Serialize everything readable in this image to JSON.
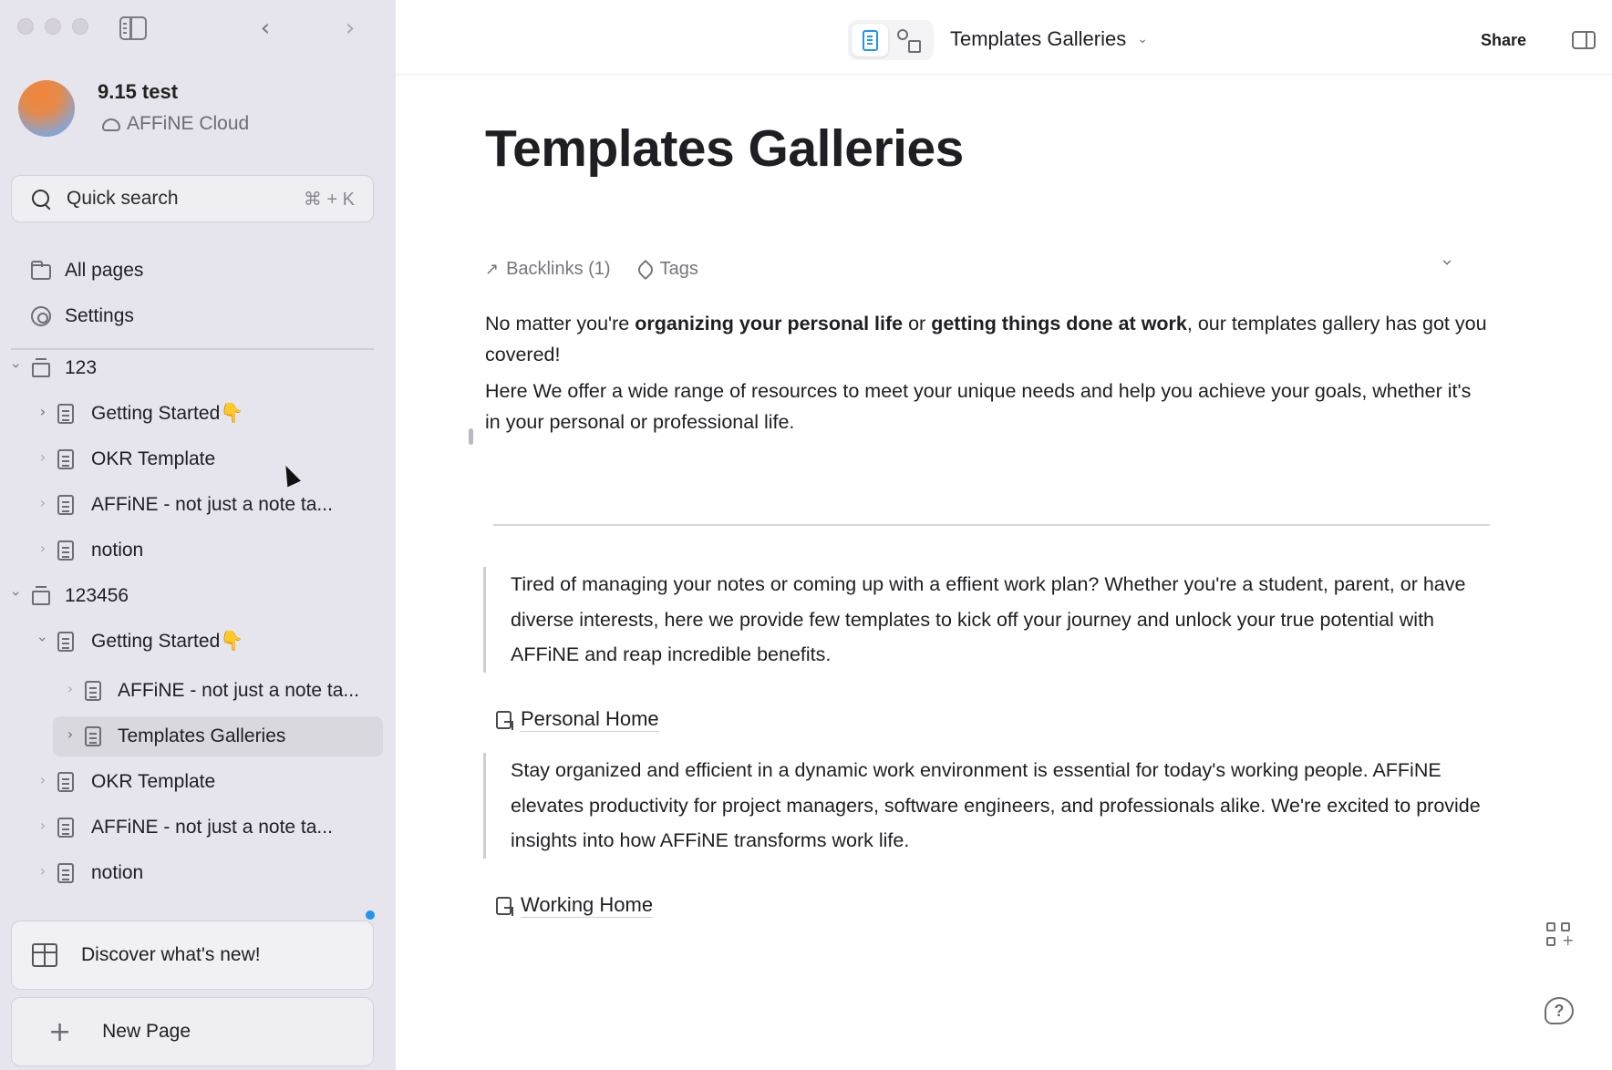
{
  "sidebar": {
    "workspace": {
      "name": "9.15 test",
      "cloud": "AFFiNE Cloud"
    },
    "search": {
      "label": "Quick search",
      "shortcut": "⌘ + K"
    },
    "nav": [
      {
        "label": "All pages",
        "icon": "folder-icon"
      },
      {
        "label": "Settings",
        "icon": "gear-icon"
      }
    ],
    "collections": [
      {
        "name": "123",
        "pages": [
          "Getting Started👇",
          "OKR Template",
          "AFFiNE - not just a note ta...",
          "notion"
        ]
      },
      {
        "name": "123456",
        "pages": [
          "Getting Started👇",
          "AFFiNE - not just a note ta...",
          "Templates Galleries",
          "OKR Template",
          "AFFiNE - not just a note ta...",
          "notion"
        ]
      }
    ],
    "discover": "Discover what's new!",
    "new_page": "New Page"
  },
  "topbar": {
    "doc_title": "Templates Galleries",
    "share": "Share"
  },
  "document": {
    "title": "Templates Galleries",
    "backlinks": "Backlinks (1)",
    "tags": "Tags",
    "intro": {
      "p1": "No matter you're ",
      "b1": "organizing your personal life",
      "p2": " or ",
      "b2": "getting things done at work",
      "p3": ", our templates gallery has got you covered!"
    },
    "para2": "Here We offer a wide range of resources to meet your unique needs and help you achieve your goals, whether it's in your personal or professional life.",
    "quote1": "Tired of managing your notes or coming up with a effient work plan? Whether you're a student, parent, or have diverse interests, here we provide  few templates to kick off your journey and unlock your true potential with AFFiNE and reap incredible benefits.",
    "link1": "Personal Home",
    "quote2": "Stay organized and efficient in a dynamic work environment is essential for today's working people. AFFiNE elevates productivity for project managers, software engineers, and professionals alike. We're excited to provide insights into how AFFiNE transforms work life.",
    "link2": "Working Home"
  },
  "colors": {
    "sidebar_bg": "#e6e4ec",
    "accent": "#1e96eb",
    "text": "#1f1f23"
  }
}
